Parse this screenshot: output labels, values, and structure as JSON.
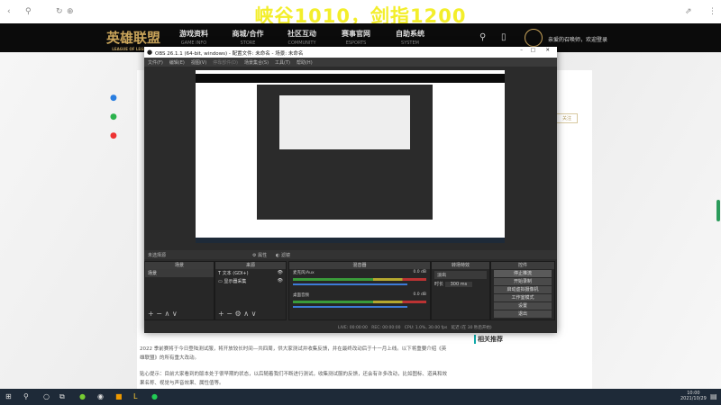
{
  "overlay_text": "峡谷1010，剑指1200",
  "site": {
    "logo": "英雄联盟",
    "logo_sub": "LEAGUE OF LEGENDS",
    "nav": [
      {
        "label": "游戏资料",
        "sub": "GAME INFO"
      },
      {
        "label": "商城/合作",
        "sub": "STORE"
      },
      {
        "label": "社区互动",
        "sub": "COMMUNITY"
      },
      {
        "label": "赛事官网",
        "sub": "ESPORTS"
      },
      {
        "label": "自助系统",
        "sub": "SYSTEM"
      }
    ],
    "login": "亲爱的召唤师，欢迎登录",
    "follow": "关注",
    "related": "相关推荐",
    "article_p1": "2022 季前赛将于今日登陆测试服，将开放较长时间—共四周，供大家测试并收集反馈，并在最终改动后于十一月上线。以下将重要介绍《英雄联盟》的所有重大改动。",
    "article_p2": "贴心提示：目前大家看到的版本处于很早期的状态，以后随着我们不断进行测试，收集测试服的反馈，还会有许多改动，比如图标、道具和效果名称、视觉与声音效果、属性值等。"
  },
  "obs": {
    "title": "OBS 26.1.1 (64-bit, windows) - 配置文件: 未命名 - 场景: 未命名",
    "menu": [
      "文件(F)",
      "编辑(E)",
      "视图(V)",
      "停靠部件(D)",
      "场景集合(S)",
      "工具(T)",
      "帮助(H)"
    ],
    "no_source": "未选择源",
    "properties": "属性",
    "filters": "滤镜",
    "docks": {
      "scenes": "场景",
      "sources": "来源",
      "mixer": "混音器",
      "transitions": "转场特效",
      "controls": "控件"
    },
    "scene_item": "场景",
    "sources": [
      "文本 (GDI+)",
      "显示器采集"
    ],
    "mixer": [
      {
        "name": "麦克风/Aux",
        "db": "0.0 dB"
      },
      {
        "name": "桌面音频",
        "db": "0.0 dB"
      }
    ],
    "transition": "淡出",
    "duration_label": "时长",
    "duration": "300 ms",
    "controls": [
      "停止推流",
      "开始录制",
      "启动虚拟摄像机",
      "工作室模式",
      "设置",
      "退出"
    ],
    "status": {
      "live": "LIVE: 00:00:00",
      "rec": "REC: 00:00:00",
      "cpu": "CPU: 1.0%, 30.00 fps",
      "delay": "延迟 (在 30 秒后开始)"
    }
  },
  "taskbar": {
    "time": "10:00",
    "date": "2021/10/29"
  }
}
